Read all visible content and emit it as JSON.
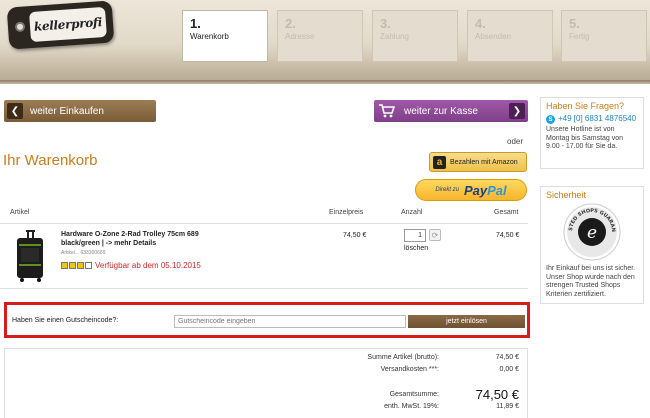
{
  "logo": {
    "text": "kellerprofi"
  },
  "steps": [
    {
      "num": "1.",
      "label": "Warenkorb",
      "active": true
    },
    {
      "num": "2.",
      "label": "Adresse",
      "active": false
    },
    {
      "num": "3.",
      "label": "Zahlung",
      "active": false
    },
    {
      "num": "4.",
      "label": "Absenden",
      "active": false
    },
    {
      "num": "5.",
      "label": "Fertig",
      "active": false
    }
  ],
  "nav": {
    "continue_shopping": "weiter Einkaufen",
    "checkout": "weiter zur Kasse",
    "or": "oder"
  },
  "page_title": "Ihr Warenkorb",
  "payments": {
    "amazon": "Bezahlen mit Amazon",
    "paypal_prefix": "Direkt zu",
    "paypal_pay": "Pay",
    "paypal_pal": "Pal"
  },
  "table": {
    "headers": {
      "artikel": "Artikel",
      "einzelpreis": "Einzelpreis",
      "anzahl": "Anzahl",
      "gesamt": "Gesamt"
    },
    "item": {
      "name": "Hardware O-Zone 2-Rad Trolley 75cm 689 black/green | -> mehr Details",
      "art_no": "Artikel... 633300689",
      "availability": "Verfügbar ab dem 05.10.2015",
      "availability_level": 3,
      "unit_price": "74,50 €",
      "quantity": "1",
      "remove": "löschen",
      "total": "74,50 €"
    }
  },
  "coupon": {
    "label": "Haben Sie einen Gutscheincode?:",
    "placeholder": "Gutscheincode eingeben",
    "button": "jetzt einlösen"
  },
  "summary": {
    "subtotal_label": "Summe Artikel (brutto):",
    "subtotal": "74,50 €",
    "shipping_label": "Versandkosten ***:",
    "shipping": "0,00 €",
    "total_label": "Gesamtsumme:",
    "total": "74,50 €",
    "vat_label": "enth. MwSt. 19%:",
    "vat": "11,89 €"
  },
  "sidebar": {
    "help_title": "Haben Sie Fragen?",
    "phone": "+49 [0] 6831 4876540",
    "hotline": "Unsere Hotline ist von Montag bis Samstag von 9.00 - 17.00 für Sie da.",
    "security_title": "Sicherheit",
    "security_text": "Ihr Einkauf bei uns ist sicher. Unser Shop wurde nach den strengen Trusted Shops Kriterien zertifiziert.",
    "seal_text": "TRUSTED SHOPS GUARANTEE"
  },
  "colors": {
    "accent": "#c97d1b",
    "brown": "#7a5c38",
    "purple": "#8e4a97",
    "alert": "#d81b1b"
  }
}
